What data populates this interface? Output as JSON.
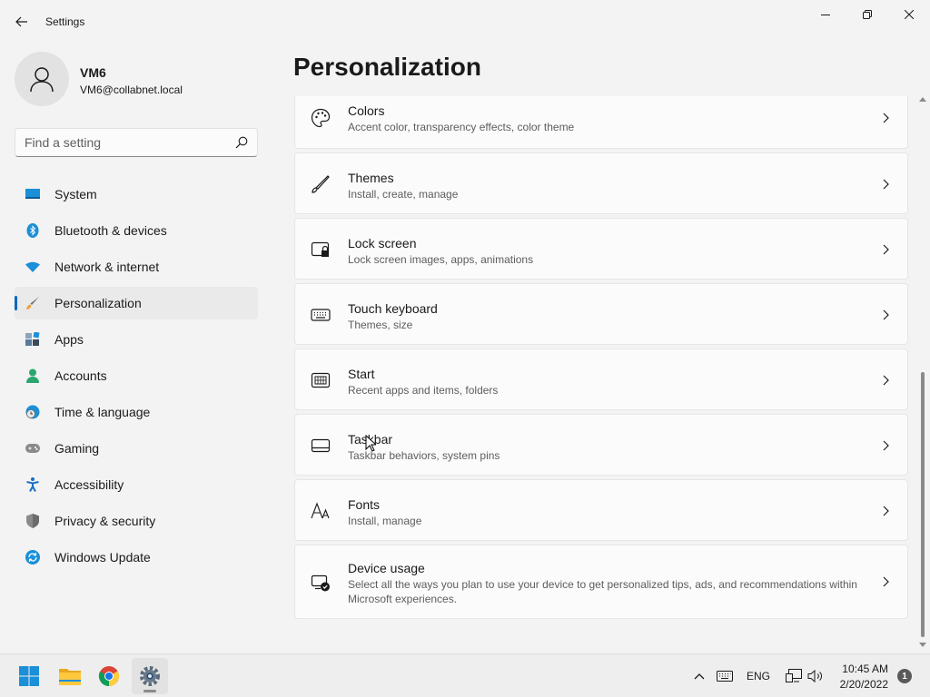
{
  "window": {
    "title": "Settings"
  },
  "profile": {
    "name": "VM6",
    "email": "VM6@collabnet.local"
  },
  "search": {
    "placeholder": "Find a setting"
  },
  "sidebar": {
    "items": [
      {
        "label": "System",
        "icon": "system-icon"
      },
      {
        "label": "Bluetooth & devices",
        "icon": "bluetooth-icon"
      },
      {
        "label": "Network & internet",
        "icon": "wifi-icon"
      },
      {
        "label": "Personalization",
        "icon": "brush-icon",
        "active": true
      },
      {
        "label": "Apps",
        "icon": "apps-icon"
      },
      {
        "label": "Accounts",
        "icon": "accounts-icon"
      },
      {
        "label": "Time & language",
        "icon": "globe-clock-icon"
      },
      {
        "label": "Gaming",
        "icon": "gamepad-icon"
      },
      {
        "label": "Accessibility",
        "icon": "accessibility-icon"
      },
      {
        "label": "Privacy & security",
        "icon": "shield-icon"
      },
      {
        "label": "Windows Update",
        "icon": "update-icon"
      }
    ]
  },
  "main": {
    "title": "Personalization",
    "cards": [
      {
        "title": "Colors",
        "desc": "Accent color, transparency effects, color theme",
        "icon": "palette-icon"
      },
      {
        "title": "Themes",
        "desc": "Install, create, manage",
        "icon": "pen-icon"
      },
      {
        "title": "Lock screen",
        "desc": "Lock screen images, apps, animations",
        "icon": "lock-screen-icon"
      },
      {
        "title": "Touch keyboard",
        "desc": "Themes, size",
        "icon": "keyboard-icon"
      },
      {
        "title": "Start",
        "desc": "Recent apps and items, folders",
        "icon": "start-icon"
      },
      {
        "title": "Taskbar",
        "desc": "Taskbar behaviors, system pins",
        "icon": "taskbar-icon"
      },
      {
        "title": "Fonts",
        "desc": "Install, manage",
        "icon": "fonts-icon"
      },
      {
        "title": "Device usage",
        "desc": "Select all the ways you plan to use your device to get personalized tips, ads, and recommendations within Microsoft experiences.",
        "icon": "device-usage-icon"
      }
    ]
  },
  "taskbar": {
    "apps": [
      "windows-start-icon",
      "file-explorer-icon",
      "chrome-icon",
      "settings-icon"
    ],
    "language": "ENG",
    "time": "10:45 AM",
    "date": "2/20/2022",
    "notifications": "1"
  },
  "colors": {
    "accent": "#0067c0",
    "background": "#f3f3f3",
    "card": "#fbfbfb"
  }
}
